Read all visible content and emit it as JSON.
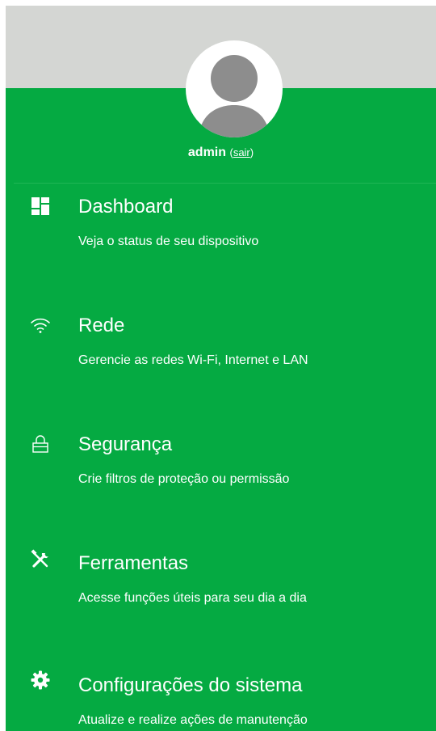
{
  "user": {
    "name": "admin",
    "logout_open": "(",
    "logout_label": "sair",
    "logout_close": ")"
  },
  "menu": {
    "items": [
      {
        "icon": "dashboard-icon",
        "title": "Dashboard",
        "description": "Veja o status de seu dispositivo"
      },
      {
        "icon": "wifi-icon",
        "title": "Rede",
        "description": "Gerencie as redes Wi-Fi, Internet e LAN"
      },
      {
        "icon": "lock-icon",
        "title": "Segurança",
        "description": "Crie filtros de proteção ou permissão"
      },
      {
        "icon": "tools-icon",
        "title": "Ferramentas",
        "description": "Acesse funções úteis para seu dia a dia"
      },
      {
        "icon": "gear-icon",
        "title": "Configurações do sistema",
        "description": "Atualize e realize ações de manutenção"
      }
    ]
  },
  "colors": {
    "sidebar_background": "#05aa42",
    "header_band": "#d4d6d3",
    "avatar_silhouette": "#8d8d8d",
    "text": "#ffffff"
  }
}
